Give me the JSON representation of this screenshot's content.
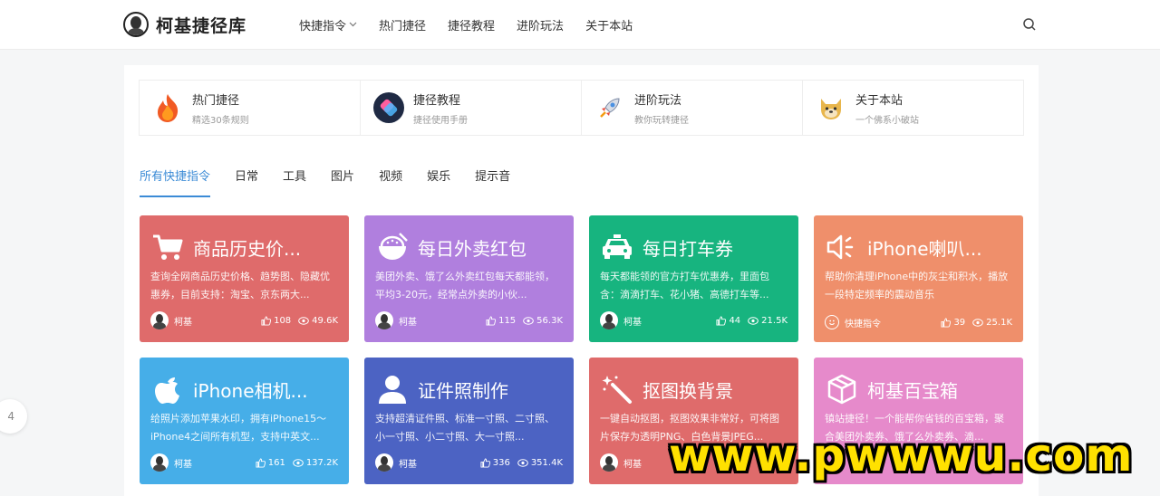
{
  "header": {
    "logo_text": "柯基捷径库",
    "nav": [
      {
        "label": "快捷指令",
        "has_dropdown": true
      },
      {
        "label": "热门捷径"
      },
      {
        "label": "捷径教程"
      },
      {
        "label": "进阶玩法"
      },
      {
        "label": "关于本站"
      }
    ],
    "search_icon": "search-icon"
  },
  "quick_links": [
    {
      "title": "热门捷径",
      "subtitle": "精选30条规则",
      "icon": "fire-icon"
    },
    {
      "title": "捷径教程",
      "subtitle": "捷径使用手册",
      "icon": "shortcuts-app-icon"
    },
    {
      "title": "进阶玩法",
      "subtitle": "教你玩转捷径",
      "icon": "rocket-icon"
    },
    {
      "title": "关于本站",
      "subtitle": "一个佛系小破站",
      "icon": "doge-icon"
    }
  ],
  "tabs": [
    {
      "label": "所有快捷指令",
      "active": true
    },
    {
      "label": "日常"
    },
    {
      "label": "工具"
    },
    {
      "label": "图片"
    },
    {
      "label": "视频"
    },
    {
      "label": "娱乐"
    },
    {
      "label": "提示音"
    }
  ],
  "cards": [
    {
      "title": "商品历史价...",
      "desc": "查询全网商品历史价格、趋势图、隐藏优惠券，目前支持：淘宝、京东两大...",
      "author": "柯基",
      "likes": "108",
      "views": "49.6K",
      "color": "#df6b6b",
      "icon": "cart-icon"
    },
    {
      "title": "每日外卖红包",
      "desc": "美团外卖、饿了么外卖红包每天都能领，平均3-20元，经常点外卖的小伙...",
      "author": "柯基",
      "likes": "115",
      "views": "56.3K",
      "color": "#b07fde",
      "icon": "bowl-icon"
    },
    {
      "title": "每日打车券",
      "desc": "每天都能领的官方打车优惠券，里面包含：滴滴打车、花小猪、高德打车等...",
      "author": "柯基",
      "likes": "44",
      "views": "21.5K",
      "color": "#17b47f",
      "icon": "taxi-icon"
    },
    {
      "title": "iPhone喇叭...",
      "desc": "帮助你清理iPhone中的灰尘和积水，播放一段特定频率的震动音乐",
      "author": "快捷指令",
      "likes": "39",
      "views": "25.1K",
      "color": "#ef8f6b",
      "icon": "speaker-icon"
    },
    {
      "title": "iPhone相机...",
      "desc": "给照片添加苹果水印，拥有iPhone15～iPhone4之间所有机型，支持中英文...",
      "author": "柯基",
      "likes": "161",
      "views": "137.2K",
      "color": "#46aee8",
      "icon": "apple-icon"
    },
    {
      "title": "证件照制作",
      "desc": "支持超清证件照、标准一寸照、二寸照、小一寸照、小二寸照、大一寸照...",
      "author": "柯基",
      "likes": "336",
      "views": "351.4K",
      "color": "#4c63c3",
      "icon": "person-icon"
    },
    {
      "title": "抠图换背景",
      "desc": "一键自动抠图，抠图效果非常好，可将图片保存为透明PNG、白色背景JPEG...",
      "author": "柯基",
      "likes": "",
      "views": "",
      "color": "#df6b6b",
      "icon": "magic-wand-icon"
    },
    {
      "title": "柯基百宝箱",
      "desc": "镇站捷径！一个能帮你省钱的百宝箱，聚合美团外卖券、饿了么外卖券、滴...",
      "author": "",
      "likes": "",
      "views": "",
      "color": "#e68acb",
      "icon": "box-icon"
    }
  ],
  "side_page": "4",
  "watermark": "www.pwwwu.com"
}
